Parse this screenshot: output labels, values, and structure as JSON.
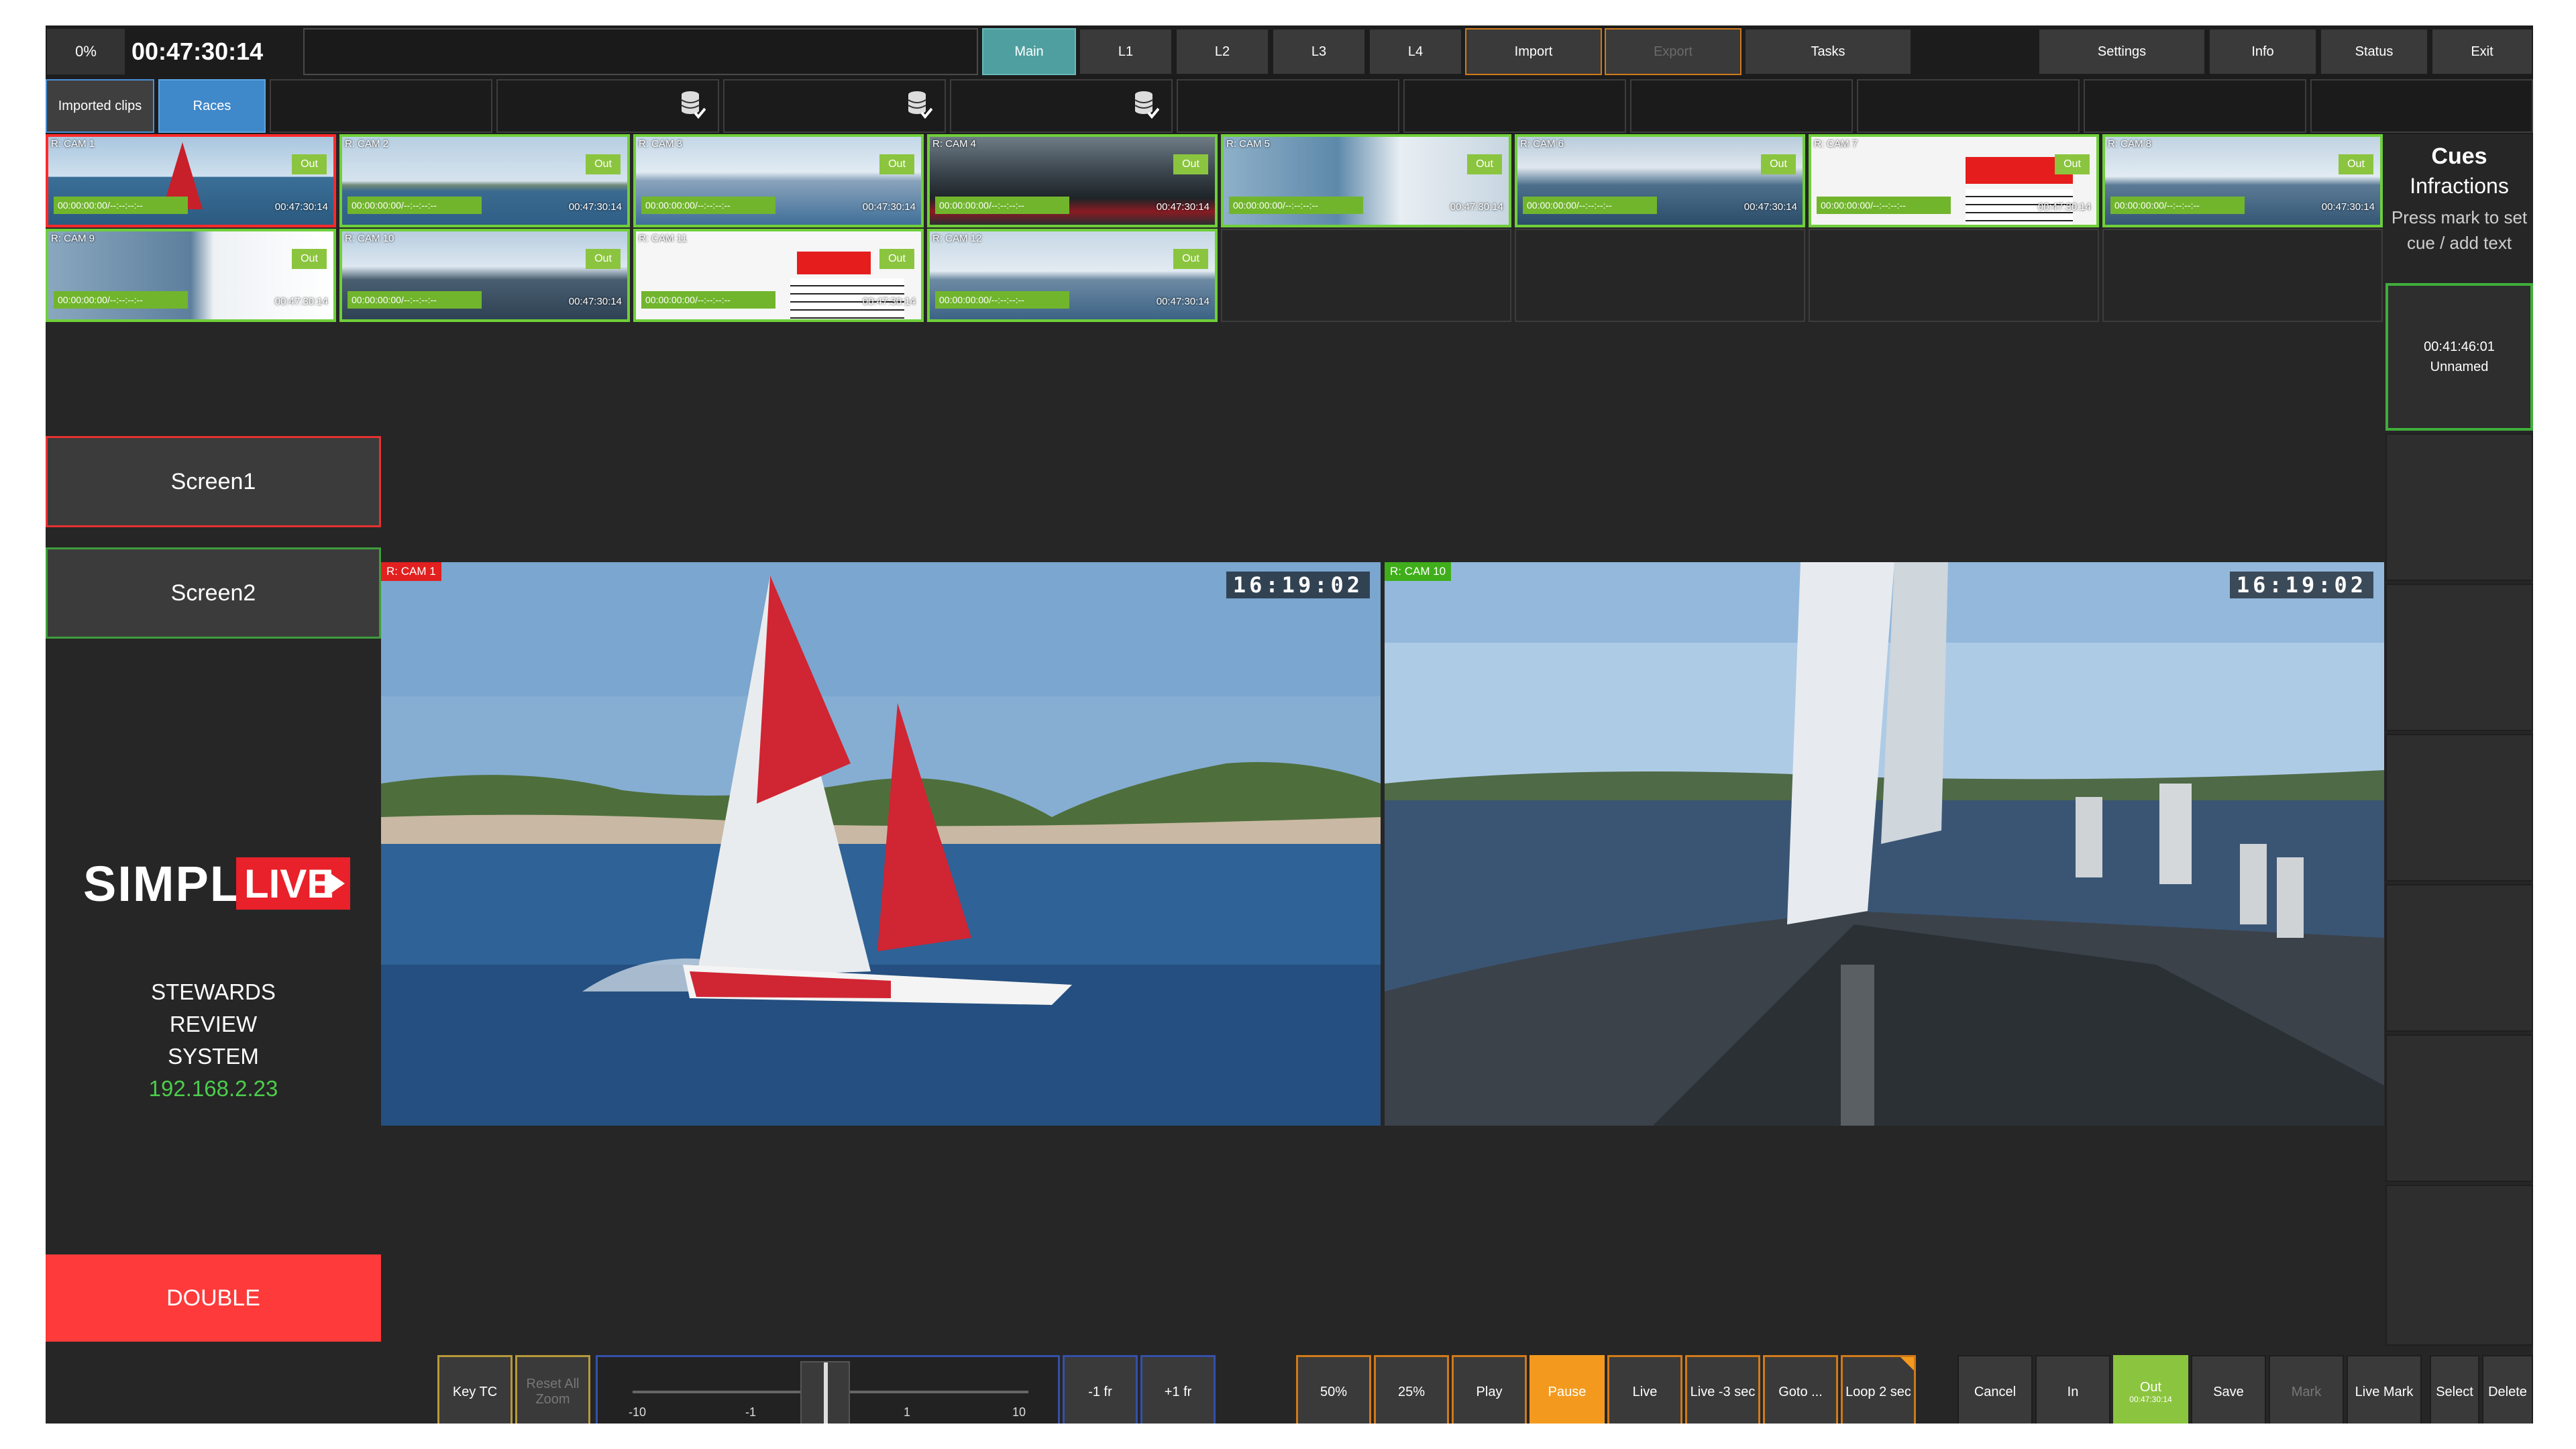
{
  "top": {
    "progress": "0%",
    "timecode": "00:47:30:14",
    "tabs": [
      "Main",
      "L1",
      "L2",
      "L3",
      "L4"
    ],
    "import": "Import",
    "export": "Export",
    "tasks": "Tasks",
    "settings": "Settings",
    "info": "Info",
    "status": "Status",
    "exit": "Exit"
  },
  "row2": {
    "imported": "Imported clips",
    "races": "Races"
  },
  "cams": [
    {
      "label": "R: CAM 1",
      "tc_in": "00:00:00:00/--:--:--:--",
      "tc_out": "00:47:30:14",
      "out": "Out"
    },
    {
      "label": "R: CAM 2",
      "tc_in": "00:00:00:00/--:--:--:--",
      "tc_out": "00:47:30:14",
      "out": "Out"
    },
    {
      "label": "R: CAM 3",
      "tc_in": "00:00:00:00/--:--:--:--",
      "tc_out": "00:47:30:14",
      "out": "Out"
    },
    {
      "label": "R: CAM 4",
      "tc_in": "00:00:00:00/--:--:--:--",
      "tc_out": "00:47:30:14",
      "out": "Out"
    },
    {
      "label": "R: CAM 5",
      "tc_in": "00:00:00:00/--:--:--:--",
      "tc_out": "00:47:30:14",
      "out": "Out"
    },
    {
      "label": "R: CAM 6",
      "tc_in": "00:00:00:00/--:--:--:--",
      "tc_out": "00:47:30:14",
      "out": "Out"
    },
    {
      "label": "R: CAM 7",
      "tc_in": "00:00:00:00/--:--:--:--",
      "tc_out": "00:47:30:14",
      "out": "Out"
    },
    {
      "label": "R: CAM 8",
      "tc_in": "00:00:00:00/--:--:--:--",
      "tc_out": "00:47:30:14",
      "out": "Out"
    },
    {
      "label": "R: CAM 9",
      "tc_in": "00:00:00:00/--:--:--:--",
      "tc_out": "00:47:30:14",
      "out": "Out"
    },
    {
      "label": "R: CAM 10",
      "tc_in": "00:00:00:00/--:--:--:--",
      "tc_out": "00:47:30:14",
      "out": "Out"
    },
    {
      "label": "R: CAM 11",
      "tc_in": "00:00:00:00/--:--:--:--",
      "tc_out": "00:47:30:14",
      "out": "Out"
    },
    {
      "label": "R: CAM 12",
      "tc_in": "00:00:00:00/--:--:--:--",
      "tc_out": "00:47:30:14",
      "out": "Out"
    }
  ],
  "cues": {
    "title": "Cues",
    "subtitle": "Infractions",
    "hint": "Press mark to set cue / add text",
    "active_tc": "00:41:46:01",
    "active_name": "Unnamed"
  },
  "left": {
    "screen1": "Screen1",
    "screen2": "Screen2",
    "logo_simply": "SIMPLY",
    "logo_live": "LIVE",
    "system_line1": "STEWARDS",
    "system_line2": "REVIEW",
    "system_line3": "SYSTEM",
    "ip": "192.168.2.23",
    "double": "DOUBLE"
  },
  "screens": {
    "s1_cam": "R: CAM 1",
    "s1_clock": "16:19:02",
    "s2_cam": "R: CAM 10",
    "s2_clock": "16:19:02"
  },
  "bottom": {
    "key_tc": "Key TC",
    "reset_zoom": "Reset All Zoom",
    "jog_labels": [
      "-10",
      "-1",
      "1",
      "10"
    ],
    "minus_fr": "-1 fr",
    "plus_fr": "+1 fr",
    "p50": "50%",
    "p25": "25%",
    "play": "Play",
    "pause": "Pause",
    "live": "Live",
    "live3": "Live -3 sec",
    "goto": "Goto ...",
    "loop": "Loop 2 sec",
    "cancel": "Cancel",
    "in": "In",
    "out": "Out",
    "out_tc": "00:47:30:14",
    "save": "Save",
    "mark": "Mark",
    "live_mark": "Live Mark",
    "select": "Select",
    "delete": "Delete"
  },
  "colors": {
    "bg": "#262626",
    "accent_green": "#8bc53f",
    "accent_red": "#ff3a3a",
    "accent_orange": "#f39a1e",
    "accent_teal": "#4f9fa0",
    "accent_blue": "#3f88c9",
    "ip_green": "#4ccd4c"
  }
}
